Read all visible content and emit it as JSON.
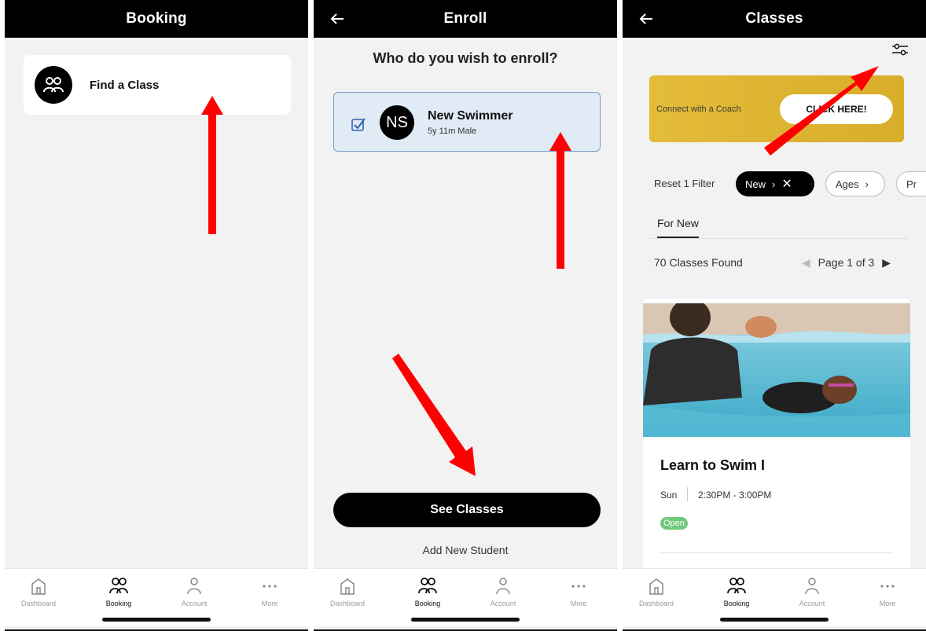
{
  "nav": {
    "items": [
      {
        "label": "Dashboard",
        "icon": "home-icon"
      },
      {
        "label": "Booking",
        "icon": "people-icon"
      },
      {
        "label": "Account",
        "icon": "user-icon"
      },
      {
        "label": "More",
        "icon": "more-icon"
      }
    ],
    "active": "Booking"
  },
  "screen1": {
    "title": "Booking",
    "find_class_label": "Find a Class"
  },
  "screen2": {
    "title": "Enroll",
    "question": "Who do you wish to enroll?",
    "student": {
      "initials": "NS",
      "name": "New  Swimmer",
      "details": "5y 11m Male",
      "selected": true
    },
    "see_classes_label": "See Classes",
    "add_student_label": "Add New Student"
  },
  "screen3": {
    "title": "Classes",
    "banner": {
      "text": "Connect with a Coach",
      "button_label": "CLICK HERE!"
    },
    "filters": {
      "reset_label": "Reset 1 Filter",
      "active_chip": "New",
      "chips": [
        "Ages",
        "Pr"
      ]
    },
    "tab_label": "For New",
    "results_count": "70 Classes Found",
    "pager_label": "Page 1 of 3",
    "class": {
      "name": "Learn to Swim I",
      "day": "Sun",
      "time": "2:30PM - 3:00PM",
      "status": "Open"
    }
  },
  "colors": {
    "topbar": "#000000",
    "panel_bg": "#f2f2f2",
    "banner_gold": "#e3bc39",
    "selected_card_bg": "#e1ebf6",
    "open_badge": "#70c97a",
    "annotation_arrow": "#ff0000"
  }
}
